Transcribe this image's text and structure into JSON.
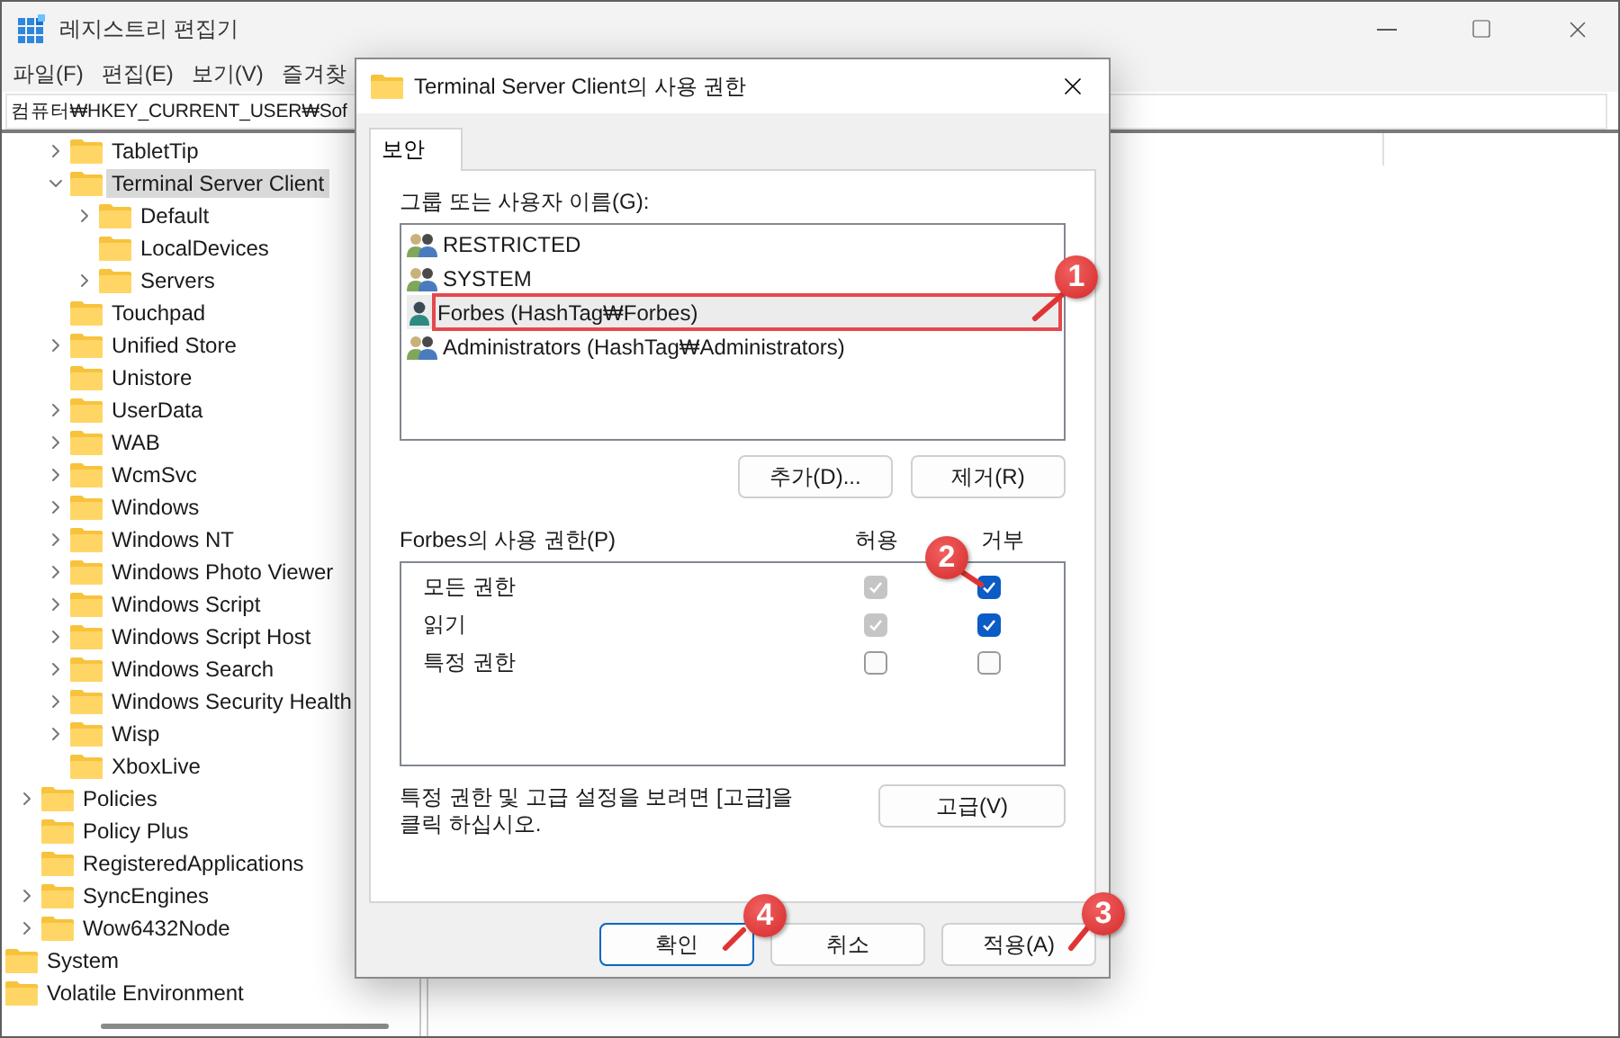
{
  "window": {
    "title": "레지스트리 편집기"
  },
  "menu": [
    "파일(F)",
    "편집(E)",
    "보기(V)",
    "즐겨찾"
  ],
  "address": "컴퓨터₩HKEY_CURRENT_USER₩Sof",
  "tree": [
    {
      "children": [
        {
          "children": [
            {
              "label": "TabletTip",
              "has_children": true,
              "expanded": false,
              "selected": false
            },
            {
              "label": "Terminal Server Client",
              "has_children": true,
              "expanded": true,
              "selected": true,
              "children": [
                {
                  "label": "Default",
                  "has_children": true,
                  "expanded": false,
                  "selected": false
                },
                {
                  "label": "LocalDevices",
                  "has_children": false,
                  "selected": false
                },
                {
                  "label": "Servers",
                  "has_children": true,
                  "expanded": false,
                  "selected": false
                }
              ]
            },
            {
              "label": "Touchpad",
              "has_children": false,
              "selected": false
            },
            {
              "label": "Unified Store",
              "has_children": true,
              "expanded": false,
              "selected": false
            },
            {
              "label": "Unistore",
              "has_children": false,
              "selected": false
            },
            {
              "label": "UserData",
              "has_children": true,
              "expanded": false,
              "selected": false
            },
            {
              "label": "WAB",
              "has_children": true,
              "expanded": false,
              "selected": false
            },
            {
              "label": "WcmSvc",
              "has_children": true,
              "expanded": false,
              "selected": false
            },
            {
              "label": "Windows",
              "has_children": true,
              "expanded": false,
              "selected": false
            },
            {
              "label": "Windows NT",
              "has_children": true,
              "expanded": false,
              "selected": false
            },
            {
              "label": "Windows Photo Viewer",
              "has_children": true,
              "expanded": false,
              "selected": false
            },
            {
              "label": "Windows Script",
              "has_children": true,
              "expanded": false,
              "selected": false
            },
            {
              "label": "Windows Script Host",
              "has_children": true,
              "expanded": false,
              "selected": false
            },
            {
              "label": "Windows Search",
              "has_children": true,
              "expanded": false,
              "selected": false
            },
            {
              "label": "Windows Security Health",
              "has_children": true,
              "expanded": false,
              "selected": false
            },
            {
              "label": "Wisp",
              "has_children": true,
              "expanded": false,
              "selected": false
            },
            {
              "label": "XboxLive",
              "has_children": false,
              "selected": false
            }
          ]
        },
        {
          "label": "Policies",
          "has_children": true,
          "expanded": false,
          "selected": false
        },
        {
          "label": "Policy Plus",
          "has_children": false,
          "selected": false
        },
        {
          "label": "RegisteredApplications",
          "has_children": false,
          "selected": false
        },
        {
          "label": "SyncEngines",
          "has_children": true,
          "expanded": false,
          "selected": false
        },
        {
          "label": "Wow6432Node",
          "has_children": true,
          "expanded": false,
          "selected": false
        }
      ]
    },
    {
      "label": "System",
      "has_children": false,
      "selected": false
    },
    {
      "label": "Volatile Environment",
      "has_children": false,
      "selected": false
    }
  ],
  "dialog": {
    "title": "Terminal Server Client의 사용 권한",
    "tabs": [
      {
        "label": "보안",
        "selected": true
      }
    ],
    "users_label": "그룹 또는 사용자 이름(G):",
    "users": [
      {
        "name": "RESTRICTED",
        "kind": "group",
        "selected": false,
        "highlighted": false
      },
      {
        "name": "SYSTEM",
        "kind": "group",
        "selected": false,
        "highlighted": false
      },
      {
        "name": "Forbes (HashTag₩Forbes)",
        "kind": "user",
        "selected": true,
        "highlighted": true
      },
      {
        "name": "Administrators (HashTag₩Administrators)",
        "kind": "group",
        "selected": false,
        "highlighted": false
      }
    ],
    "user_buttons": [
      "추가(D)...",
      "제거(R)"
    ],
    "permissions": {
      "label": "Forbes의 사용 권한(P)",
      "allow_header": "허용",
      "deny_header": "거부",
      "rows": [
        {
          "name": "모든 권한",
          "allow": {
            "checked": true,
            "disabled": true
          },
          "deny": {
            "checked": true,
            "disabled": false
          }
        },
        {
          "name": "읽기",
          "allow": {
            "checked": true,
            "disabled": true
          },
          "deny": {
            "checked": true,
            "disabled": false
          }
        },
        {
          "name": "특정 권한",
          "allow": {
            "checked": false,
            "disabled": false
          },
          "deny": {
            "checked": false,
            "disabled": false
          }
        }
      ]
    },
    "advanced_text": "특정 권한 및 고급 설정을 보려면 [고급]을 클릭 하십시오.",
    "advanced_button": "고급(V)",
    "buttons": [
      {
        "label": "확인",
        "default": true
      },
      {
        "label": "취소",
        "default": false
      },
      {
        "label": "적용(A)",
        "default": false
      }
    ]
  },
  "annotations": [
    "1",
    "2",
    "3",
    "4"
  ]
}
